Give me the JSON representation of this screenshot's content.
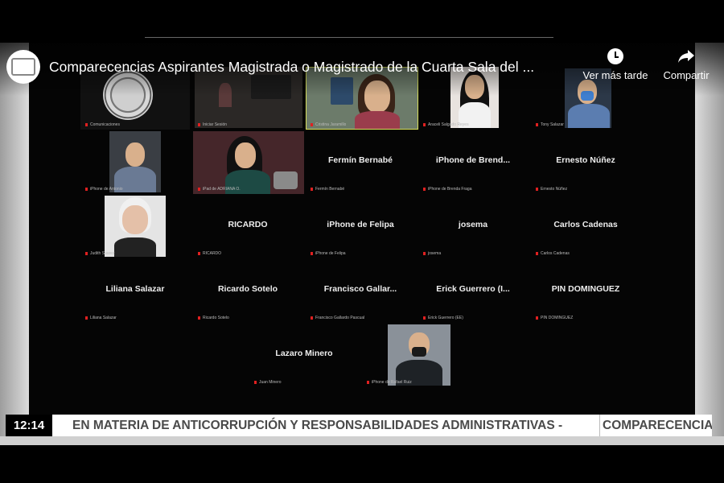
{
  "video": {
    "title": "Comparecencias Aspirantes Magistrada o Magistrado de la Cuarta Sala del ...",
    "actions": {
      "watch_later": "Ver más tarde",
      "share": "Compartir"
    }
  },
  "participants": [
    {
      "name": "",
      "caption": "Comunicaciones"
    },
    {
      "name": "",
      "caption": "Iniciar Sesión"
    },
    {
      "name": "",
      "caption": "Cristina Jaramillo"
    },
    {
      "name": "",
      "caption": "Araceli Salgado Reyes"
    },
    {
      "name": "",
      "caption": "Tony Salazar"
    },
    {
      "name": "",
      "caption": "iPhone de Antonio"
    },
    {
      "name": "",
      "caption": "iPad de ADRIANA O."
    },
    {
      "name": "Fermín Bernabé",
      "caption": "Fermín Bernabé"
    },
    {
      "name": "iPhone de Brend...",
      "caption": "iPhone de Brenda Fraga"
    },
    {
      "name": "Ernesto Núñez",
      "caption": "Ernesto Núñez"
    },
    {
      "name": "",
      "caption": "Judith Suarez"
    },
    {
      "name": "RICARDO",
      "caption": "RICARDO"
    },
    {
      "name": "iPhone de Felipa",
      "caption": "iPhone de Felipa"
    },
    {
      "name": "josema",
      "caption": "josema"
    },
    {
      "name": "Carlos Cadenas",
      "caption": "Carlos Cadenas"
    },
    {
      "name": "Liliana Salazar",
      "caption": "Liliana Salazar"
    },
    {
      "name": "Ricardo Sotelo",
      "caption": "Ricardo Sotelo"
    },
    {
      "name": "Francisco Gallar...",
      "caption": "Francisco Gallardo Pascual"
    },
    {
      "name": "Erick Guerrero (I...",
      "caption": "Erick Guerrero (EE)"
    },
    {
      "name": "PIN DOMINGUEZ",
      "caption": "PIN DOMINGUEZ"
    },
    {
      "name": "Lazaro Minero",
      "caption": "Juan Minero"
    },
    {
      "name": "",
      "caption": "iPhone de Rafael Ruiz"
    }
  ],
  "lower_third": {
    "time": "12:14",
    "ticker": "EN MATERIA DE ANTICORRUPCIÓN Y RESPONSABILIDADES ADMINISTRATIVAS -",
    "label": "COMPARECENCIA"
  }
}
